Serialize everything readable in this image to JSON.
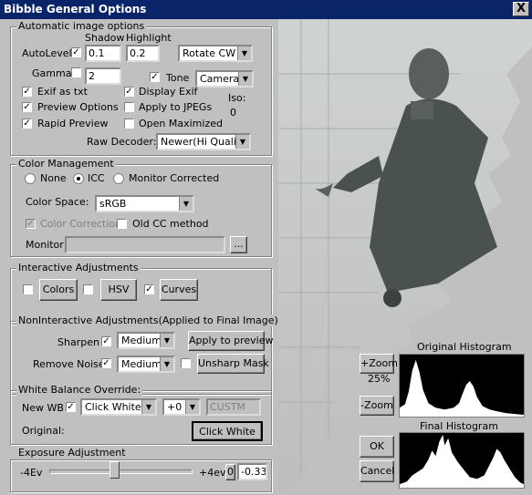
{
  "window": {
    "title": "Bibble General Options",
    "close": "X"
  },
  "auto": {
    "legend": "Automatic image options",
    "shadow_label": "Shadow",
    "highlight_label": "Highlight",
    "autolevel_label": "AutoLevel",
    "shadow_value": "0.1",
    "highlight_value": "0.2",
    "rotate": "Rotate CW",
    "gamma_label": "Gamma",
    "gamma_value": "2",
    "tone_label": "Tone",
    "tone_value": "Camera",
    "exif_txt": "Exif as txt",
    "display_exif": "Display Exif",
    "iso_label": "Iso:",
    "iso_value": "0",
    "preview_options": "Preview Options",
    "apply_jpegs": "Apply to JPEGs",
    "rapid_preview": "Rapid Preview",
    "open_maximized": "Open Maximized",
    "raw_decoder_label": "Raw Decoder:",
    "raw_decoder_value": "Newer(Hi Quality)"
  },
  "color": {
    "legend": "Color Management",
    "none": "None",
    "icc": "ICC",
    "monitor_corrected": "Monitor Corrected",
    "space_label": "Color Space:",
    "space_value": "sRGB",
    "color_correction": "Color Correction",
    "old_cc": "Old CC method",
    "monitor_label": "Monitor:",
    "browse": "..."
  },
  "interactive": {
    "legend": "Interactive Adjustments",
    "colors": "Colors",
    "hsv": "HSV",
    "curves": "Curves"
  },
  "noninteractive": {
    "legend": "NonInteractive Adjustments(Applied to Final Image)",
    "sharpen_label": "Sharpen",
    "sharpen_value": "Medium",
    "apply_preview": "Apply to preview",
    "noise_label": "Remove Noise",
    "noise_value": "Medium",
    "unsharp": "Unsharp Mask"
  },
  "wb": {
    "legend": "White Balance Override:",
    "new_wb": "New WB",
    "mode": "Click White",
    "offset": "+0",
    "custom": "CUSTM",
    "original": "Original:",
    "click_white_btn": "Click White"
  },
  "exposure": {
    "legend": "Exposure Adjustment",
    "min": "-4Ev",
    "max": "+4ev",
    "zero": "0",
    "value": "-0.33",
    "level": 0.46
  },
  "preview": {
    "zoom_in": "+Zoom",
    "zoom_pct": "25%",
    "zoom_out": "-Zoom",
    "orig_hist": "Original Histogram",
    "final_hist": "Final Histogram",
    "ok": "OK",
    "cancel": "Cancel"
  }
}
